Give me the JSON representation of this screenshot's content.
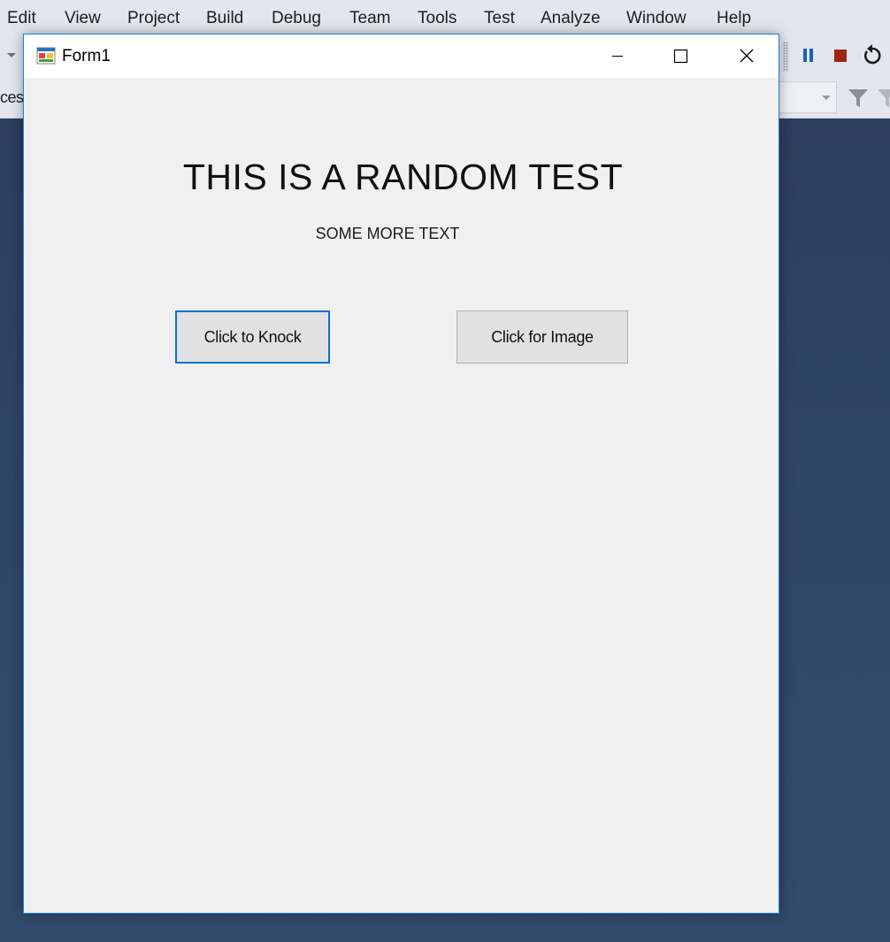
{
  "menubar": {
    "items": [
      {
        "label": "Edit"
      },
      {
        "label": "View"
      },
      {
        "label": "Project"
      },
      {
        "label": "Build"
      },
      {
        "label": "Debug"
      },
      {
        "label": "Team"
      },
      {
        "label": "Tools"
      },
      {
        "label": "Test"
      },
      {
        "label": "Analyze"
      },
      {
        "label": "Window"
      },
      {
        "label": "Help"
      }
    ]
  },
  "toolbar": {
    "left_truncated_text": "ces:",
    "icons": [
      "pause-icon",
      "stop-icon",
      "restart-icon",
      "filter-icon"
    ],
    "colors": {
      "pause": "#1a5fb4",
      "stop": "#a1260d"
    }
  },
  "form": {
    "title": "Form1",
    "heading": "THIS IS A RANDOM TEST",
    "subheading": "SOME MORE TEXT",
    "buttons": {
      "knock_label": "Click to Knock",
      "image_label": "Click for Image"
    },
    "accent_color": "#0a6fd1"
  }
}
